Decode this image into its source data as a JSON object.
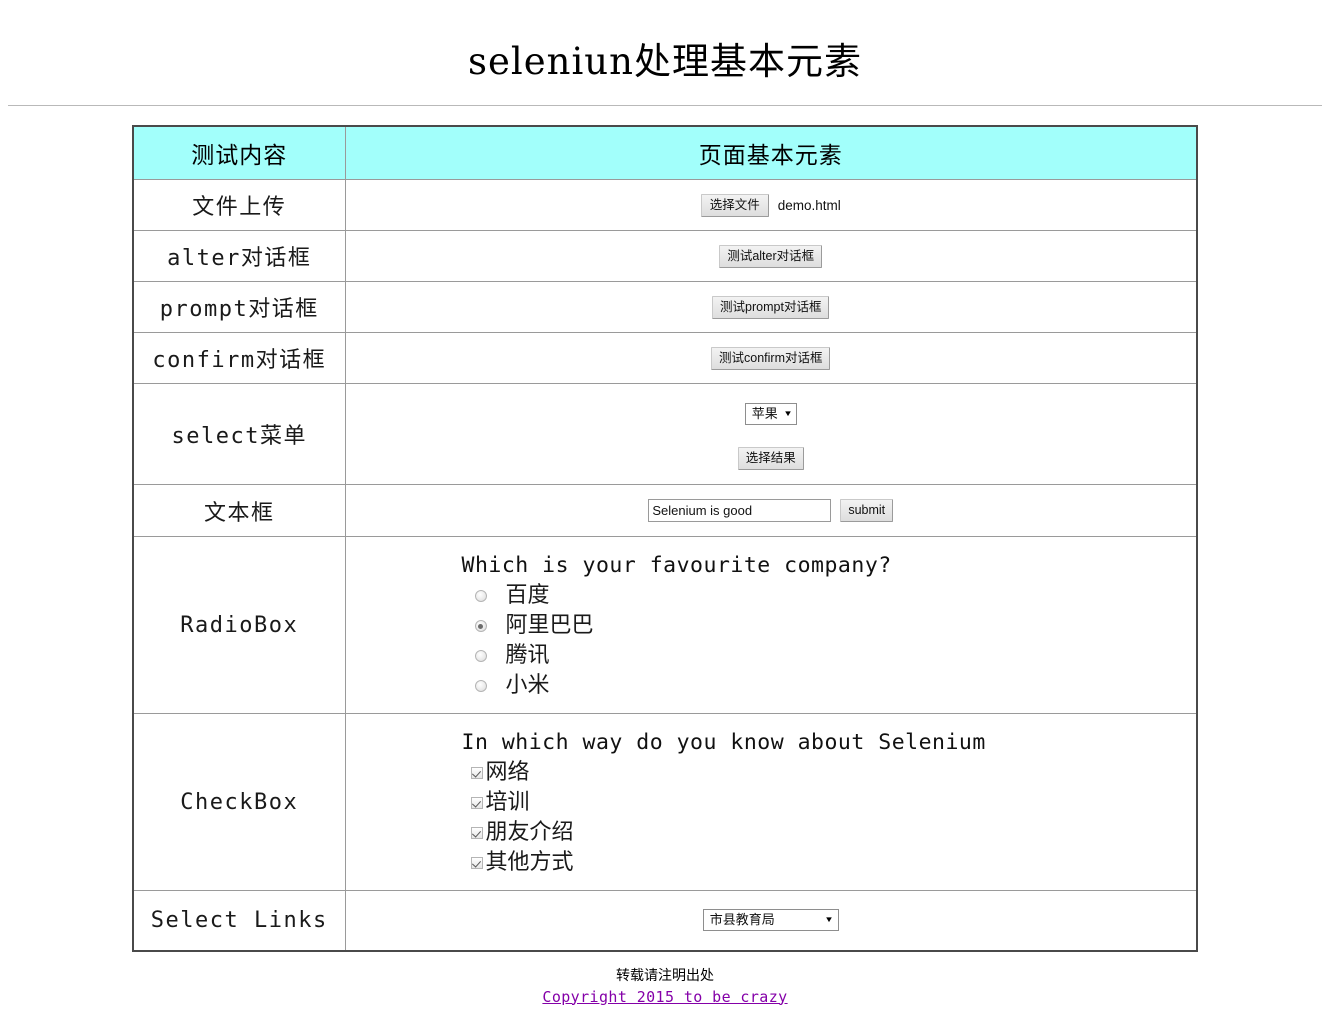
{
  "page": {
    "title": "seleniun处理基本元素"
  },
  "table": {
    "headers": [
      "测试内容",
      "页面基本元素"
    ],
    "rows": {
      "file_upload": {
        "label": "文件上传",
        "choose_button": "选择文件",
        "file_name": "demo.html"
      },
      "alert_dialog": {
        "label": "alter对话框",
        "button": "测试alter对话框"
      },
      "prompt_dialog": {
        "label": "prompt对话框",
        "button": "测试prompt对话框"
      },
      "confirm_dialog": {
        "label": "confirm对话框",
        "button": "测试confirm对话框"
      },
      "select_menu": {
        "label": "select菜单",
        "selected_option": "苹果",
        "arrow": "▼",
        "result_button": "选择结果"
      },
      "textbox": {
        "label": "文本框",
        "input_value": "Selenium is good",
        "input_placeholder": "",
        "submit_button": "submit"
      },
      "radiobox": {
        "label": "RadioBox",
        "question": "Which is your favourite company?",
        "options": [
          {
            "text": "百度",
            "checked": false
          },
          {
            "text": "阿里巴巴",
            "checked": true
          },
          {
            "text": "腾讯",
            "checked": false
          },
          {
            "text": "小米",
            "checked": false
          }
        ]
      },
      "checkbox": {
        "label": "CheckBox",
        "question": "In which way do you know about Selenium",
        "options": [
          {
            "text": "网络",
            "checked": true
          },
          {
            "text": "培训",
            "checked": true
          },
          {
            "text": "朋友介绍",
            "checked": true
          },
          {
            "text": "其他方式",
            "checked": true
          }
        ]
      },
      "select_links": {
        "label": "Select Links",
        "selected_option": "市县教育局",
        "arrow": "▼"
      }
    }
  },
  "footer": {
    "note": "转载请注明出处",
    "link": "Copyright 2015 to be crazy"
  },
  "colors": {
    "header_background": "#a2fffb",
    "link": "#8400a8",
    "table_border": "#4a4a4a"
  }
}
